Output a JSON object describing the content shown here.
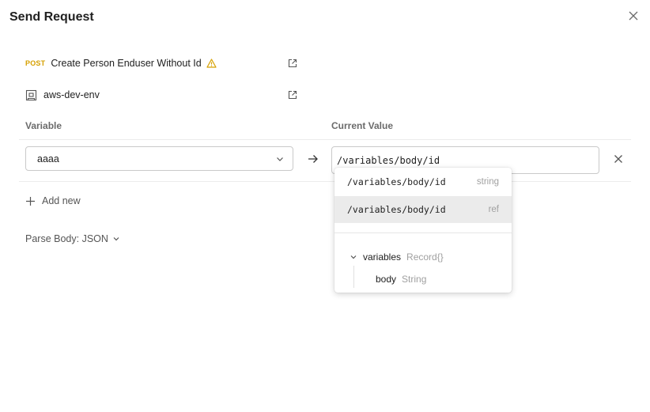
{
  "dialog": {
    "title": "Send Request"
  },
  "request": {
    "method": "POST",
    "name": "Create Person Enduser Without Id"
  },
  "environment": {
    "name": "aws-dev-env"
  },
  "table": {
    "variable_header": "Variable",
    "current_value_header": "Current Value",
    "row": {
      "variable": "aaaa",
      "current_value": "/variables/body/id"
    }
  },
  "add_new_label": "Add new",
  "parse_body_label": "Parse Body: JSON",
  "dropdown": {
    "options": [
      {
        "path": "/variables/body/id",
        "type": "string"
      },
      {
        "path": "/variables/body/id",
        "type": "ref"
      }
    ],
    "tree": {
      "root": {
        "name": "variables",
        "type": "Record{}"
      },
      "child": {
        "name": "body",
        "type": "String"
      }
    }
  },
  "colors": {
    "method_post": "#d6a000",
    "warning": "#d6a000",
    "highlight": "#ebebeb"
  },
  "icons": [
    "close-icon",
    "warning-icon",
    "external-link-icon",
    "environment-icon",
    "chevron-down-icon",
    "arrow-right-icon",
    "plus-icon"
  ]
}
